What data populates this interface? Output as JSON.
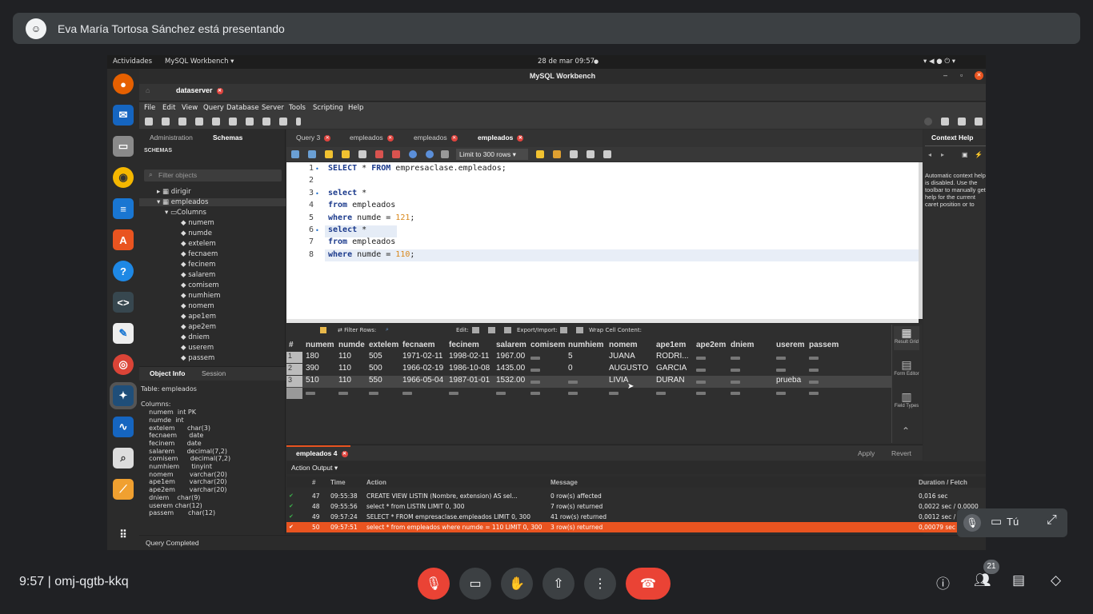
{
  "meet": {
    "presenter": "Eva María Tortosa Sánchez está presentando",
    "avatar": "☺",
    "time": "9:57",
    "meeting_code": "omj-qgtb-kkq",
    "participants": "21",
    "self_label": "Tú"
  },
  "ubuntu": {
    "activities": "Actividades",
    "app_menu": "MySQL Workbench ▾",
    "clock": "28 de mar  09:57",
    "dot": "●"
  },
  "workbench": {
    "title": "MySQL Workbench",
    "connection_tab": "dataserver",
    "menu": [
      "File",
      "Edit",
      "View",
      "Query",
      "Database",
      "Server",
      "Tools",
      "Scripting",
      "Help"
    ],
    "panel_tabs": [
      "Administration",
      "Schemas"
    ],
    "schemas_header": "SCHEMAS",
    "filter_placeholder": "Filter objects",
    "tree": [
      "dirigir",
      "empleados",
      "Columns",
      "numem",
      "numde",
      "extelem",
      "fecnaem",
      "fecinem",
      "salarem",
      "comisem",
      "numhiem",
      "nomem",
      "ape1em",
      "ape2em",
      "dniem",
      "userem",
      "passem"
    ],
    "info_tabs": [
      "Object Info",
      "Session"
    ],
    "object_info": "Table: empleados\n\nColumns:\n    numem  int PK\n    numde  int\n    extelem      char(3)\n    fecnaem      date\n    fecinem      date\n    salarem      decimal(7,2)\n    comisem      decimal(7,2)\n    numhiem      tinyint\n    nomem        varchar(20)\n    ape1em       varchar(20)\n    ape2em       varchar(20)\n    dniem    char(9)\n    userem char(12)\n    passem       char(12)",
    "status": "Query Completed",
    "query_tabs": [
      "Query 3",
      "empleados",
      "empleados",
      "empleados"
    ],
    "limit": "Limit to 300 rows",
    "code_lines": [
      {
        "n": "1",
        "kw1": "SELECT",
        "t1": " * ",
        "kw2": "FROM",
        "t2": " empresaclase.empleados;",
        "bullet": "•"
      },
      {
        "n": "2"
      },
      {
        "n": "3",
        "kw1": "select",
        "t1": " *",
        "bullet": "•"
      },
      {
        "n": "4",
        "kw1": "from",
        "t1": " empleados"
      },
      {
        "n": "5",
        "kw1": "where",
        "t1": " numde = ",
        "num": "121",
        ";": ";"
      },
      {
        "n": "6",
        "kw1": "select",
        "t1": " *",
        "bullet": "•"
      },
      {
        "n": "7",
        "kw1": "from",
        "t1": " empleados"
      },
      {
        "n": "8",
        "kw1": "where",
        "t1": " numde = ",
        "num": "110",
        ";": ";"
      }
    ],
    "grid_toolbar": {
      "filter": "Filter Rows:",
      "edit": "Edit:",
      "export": "Export/Import:",
      "wrap": "Wrap Cell Content:"
    },
    "grid_columns": [
      "#",
      "numem",
      "numde",
      "extelem",
      "fecnaem",
      "fecinem",
      "salarem",
      "comisem",
      "numhiem",
      "nomem",
      "ape1em",
      "ape2em",
      "dniem",
      "userem",
      "passem"
    ],
    "grid_rows": [
      [
        "1",
        "180",
        "110",
        "505",
        "1971-02-11",
        "1998-02-11",
        "1967.00",
        "",
        "5",
        "JUANA",
        "RODRI...",
        "",
        "",
        "",
        ""
      ],
      [
        "2",
        "390",
        "110",
        "500",
        "1966-02-19",
        "1986-10-08",
        "1435.00",
        "",
        "0",
        "AUGUSTO",
        "GARCIA",
        "",
        "",
        "",
        ""
      ],
      [
        "3",
        "510",
        "110",
        "550",
        "1966-05-04",
        "1987-01-01",
        "1532.00",
        "",
        "",
        "LIVIA",
        "DURAN",
        "",
        "",
        "prueba",
        ""
      ]
    ],
    "side_labels": [
      "Result Grid",
      "Form Editor",
      "Field Types"
    ],
    "context_help_title": "Context Help",
    "context_help_text": "Automatic context help is disabled. Use the toolbar to manually get help for the current caret position or to",
    "result_tab": "empleados 4",
    "apply": "Apply",
    "revert": "Revert",
    "output_select": "Action Output ▾",
    "output_columns": [
      "#",
      "Time",
      "Action",
      "Message",
      "Duration / Fetch"
    ],
    "output_rows": [
      {
        "n": "47",
        "time": "09:55:38",
        "action": "CREATE VIEW LISTIN        (Nombre, extension) AS      sel...",
        "msg": "0 row(s) affected",
        "dur": "0,016 sec"
      },
      {
        "n": "48",
        "time": "09:55:56",
        "action": "select * from LISTIN LIMIT 0, 300",
        "msg": "7 row(s) returned",
        "dur": "0,0022 sec / 0,0000"
      },
      {
        "n": "49",
        "time": "09:57:24",
        "action": "SELECT * FROM empresaclase.empleados LIMIT 0, 300",
        "msg": "41 row(s) returned",
        "dur": "0,0012 sec / 0"
      },
      {
        "n": "50",
        "time": "09:57:51",
        "action": "select * from empleados where numde = 110 LIMIT 0, 300",
        "msg": "3 row(s) returned",
        "dur": "0,00079 sec /"
      }
    ],
    "ok_icon": "✔"
  }
}
